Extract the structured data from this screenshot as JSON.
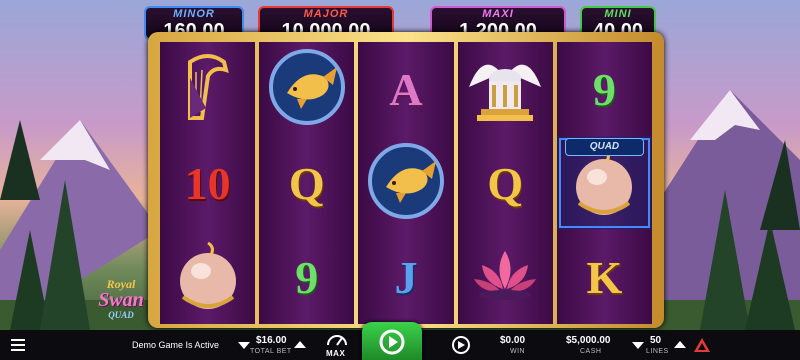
{
  "jackpots": [
    {
      "label": "MINOR",
      "value": "160.00",
      "color": "#3f8df2"
    },
    {
      "label": "MAJOR",
      "value": "10,000.00",
      "color": "#e43a3a"
    },
    {
      "label": "MAXI",
      "value": "1,200.00",
      "color": "#d05ad0"
    },
    {
      "label": "MINI",
      "value": "40.00",
      "color": "#45c94a"
    }
  ],
  "reels": [
    [
      {
        "type": "image",
        "icon": "harp-icon"
      },
      {
        "type": "text",
        "text": "10",
        "tone": "red"
      },
      {
        "type": "image",
        "icon": "golden-egg-icon"
      }
    ],
    [
      {
        "type": "image",
        "icon": "koi-fish-icon"
      },
      {
        "type": "text",
        "text": "Q",
        "tone": "gold"
      },
      {
        "type": "text",
        "text": "9",
        "tone": "green"
      }
    ],
    [
      {
        "type": "text",
        "text": "A",
        "tone": "pink"
      },
      {
        "type": "image",
        "icon": "koi-fish-icon"
      },
      {
        "type": "text",
        "text": "J",
        "tone": "blue"
      }
    ],
    [
      {
        "type": "image",
        "icon": "winged-temple-icon"
      },
      {
        "type": "text",
        "text": "Q",
        "tone": "gold"
      },
      {
        "type": "image",
        "icon": "lotus-icon"
      }
    ],
    [
      {
        "type": "text",
        "text": "9",
        "tone": "green"
      },
      {
        "type": "image",
        "icon": "golden-egg-icon",
        "quad": true
      },
      {
        "type": "text",
        "text": "K",
        "tone": "gold"
      }
    ]
  ],
  "logo": {
    "line1": "Royal",
    "line2": "Swan",
    "line3": "QUAD"
  },
  "bottom_bar": {
    "status": "Demo Game Is Active",
    "total_bet_value": "$16.00",
    "total_bet_label": "TOTAL BET",
    "max_label": "MAX",
    "win_value": "$0.00",
    "win_label": "WIN",
    "cash_value": "$5,000.00",
    "cash_label": "CASH",
    "lines_value": "50",
    "lines_label": "LINES"
  }
}
